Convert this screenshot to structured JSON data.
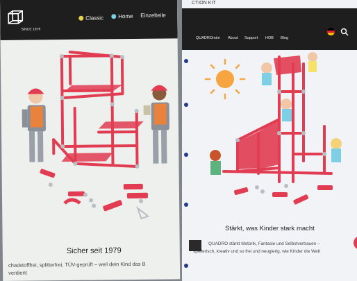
{
  "left_page": {
    "logo_text": "SINCE 1979",
    "nav": [
      {
        "label": "Classic",
        "color": "#e9d14a"
      },
      {
        "label": "Home",
        "color": "#7ccfe5"
      },
      {
        "label": "Einzelteile"
      }
    ],
    "caption": "Sicher seit 1979",
    "body_lines": [
      "chadstofffrei, splitterfrei, TÜV-geprüft – weil dein Kind das B",
      "verdient"
    ]
  },
  "right_page": {
    "top_text": "CTION KIT",
    "nav": [
      "QUADROmini",
      "About",
      "Support",
      "HOB",
      "Blog"
    ],
    "language_icon": "german-flag-icon",
    "search_icon": "search-icon",
    "caption": "Stärkt, was Kinder stark macht",
    "body_lines": [
      "QUADRO stärkt Motorik, Fantasie und Selbstvertrauen –",
      "spielerisch, kreativ und so frei und neugierig, wie Kinder die Welt"
    ]
  },
  "colors": {
    "frame_red": "#e23c52",
    "connector_grey": "#b9bec4",
    "header_dark": "#1e1e1e",
    "sun": "#f7a540"
  }
}
